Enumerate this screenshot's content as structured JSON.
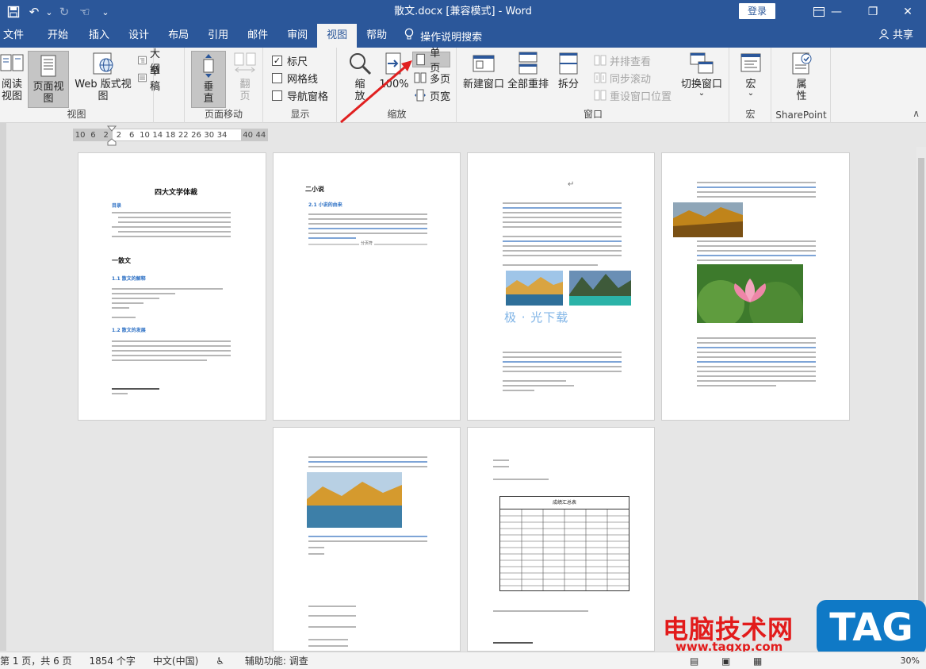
{
  "window": {
    "title": "散文.docx [兼容模式] - Word",
    "login_label": "登录",
    "minimize": "—",
    "restore": "❐",
    "close": "✕"
  },
  "qat": {
    "save_icon": "💾",
    "undo_icon": "↶",
    "undo_arrow": "⌄",
    "redo_icon": "↻",
    "touch_icon": "☜",
    "customize_icon": "⌄"
  },
  "tabs": [
    {
      "label": "文件"
    },
    {
      "label": "开始"
    },
    {
      "label": "插入"
    },
    {
      "label": "设计"
    },
    {
      "label": "布局"
    },
    {
      "label": "引用"
    },
    {
      "label": "邮件"
    },
    {
      "label": "审阅"
    },
    {
      "label": "视图"
    },
    {
      "label": "帮助"
    }
  ],
  "active_tab": "视图",
  "tell_me": {
    "icon": "💡",
    "label": "操作说明搜索"
  },
  "share": {
    "label": "共享"
  },
  "ribbon": {
    "views": {
      "label": "视图",
      "read_mode_line1": "阅读",
      "read_mode_line2": "视图",
      "print_layout": "页面视图",
      "web_layout": "Web 版式视图",
      "outline": "大纲",
      "draft": "草稿"
    },
    "page_movement": {
      "label": "页面移动",
      "vertical": "垂\n直",
      "side_to_side": "翻\n页"
    },
    "show": {
      "label": "显示",
      "ruler": "标尺",
      "ruler_checked": "✓",
      "gridlines": "网格线",
      "nav_pane": "导航窗格"
    },
    "zoom": {
      "label": "缩放",
      "zoom": "缩\n放",
      "hundred": "100%",
      "one_page": "单页",
      "multiple_pages": "多页",
      "page_width": "页宽"
    },
    "window": {
      "label": "窗口",
      "new_window": "新建窗口",
      "arrange_all": "全部重排",
      "split": "拆分",
      "side_by_side": "并排查看",
      "sync_scroll": "同步滚动",
      "reset_position": "重设窗口位置",
      "switch_windows": "切换窗口",
      "switch_arrow": "⌄"
    },
    "macros": {
      "label": "宏",
      "button": "宏",
      "arrow": "⌄"
    },
    "sharepoint": {
      "label": "SharePoint",
      "button_line1": "属",
      "button_line2": "性"
    }
  },
  "ruler": {
    "ticks": [
      "10",
      "6",
      "2",
      "2",
      "6",
      "10",
      "14",
      "18",
      "22",
      "26",
      "30",
      "34",
      "",
      "40",
      "44"
    ]
  },
  "pages": {
    "p1": {
      "title": "四大文学体裁",
      "toc": "目录",
      "h1": "一散文",
      "h2a": "1.1 散文的解释",
      "h2b": "1.2 散文的发展"
    },
    "p2": {
      "title": "二小说",
      "h2": "2.1 小说的由来",
      "end": "分页符"
    },
    "p3": {
      "title": "↵",
      "wordart": "极 · 光下载"
    },
    "p6": {
      "table_title": "成绩汇总表"
    }
  },
  "status": {
    "page": "第 1 页，共 6 页",
    "words": "1854 个字",
    "language": "中文(中国)",
    "accessibility": "辅助功能: 调查",
    "zoom": "30%"
  },
  "watermark": {
    "brand": "电脑技术网",
    "url": "www.tagxp.com",
    "tag": "TAG"
  },
  "colors": {
    "accent": "#2b579a",
    "arrow": "#e02020"
  }
}
